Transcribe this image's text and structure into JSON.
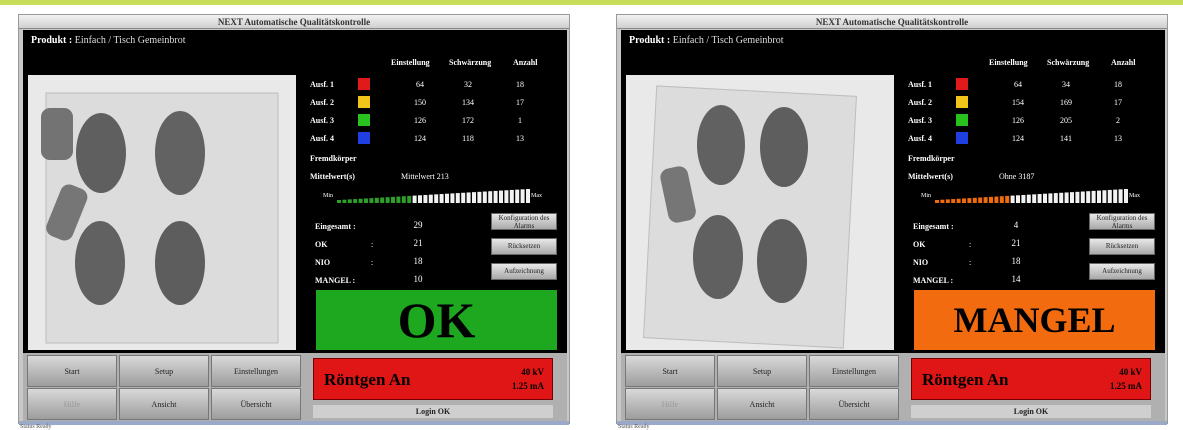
{
  "screens": [
    {
      "id": "left",
      "title": "NEXT Automatische Qualitätskontrolle",
      "produkt_label": "Produkt :",
      "produkt_value": "Einfach / Tisch Gemeinbrot",
      "headers": [
        "Einstellung",
        "Schwärzung",
        "Anzahl"
      ],
      "auswertung": [
        {
          "label": "Ausf. 1",
          "color": "#e01a1a",
          "v1": "64",
          "v2": "32",
          "v3": "18"
        },
        {
          "label": "Ausf. 2",
          "color": "#f0c419",
          "v1": "150",
          "v2": "134",
          "v3": "17"
        },
        {
          "label": "Ausf. 3",
          "color": "#27c21e",
          "v1": "126",
          "v2": "172",
          "v3": "1"
        },
        {
          "label": "Ausf. 4",
          "color": "#1f3fe0",
          "v1": "124",
          "v2": "118",
          "v3": "13"
        }
      ],
      "fremdkorper_label": "Fremdkörper",
      "mittelwert_label": "Mittelwert(s)",
      "mittelwert_value": "Mittelwert 213",
      "gauge_min": "Min",
      "gauge_max": "Max",
      "gauge_color": "#2f9e2a",
      "gauge_level": 0.4,
      "counts": [
        {
          "label": "Eingesamt :",
          "value": "29"
        },
        {
          "label": "OK",
          "value": "21"
        },
        {
          "label": "NIO",
          "value": "18"
        },
        {
          "label": "MANGEL :",
          "value": "10"
        }
      ],
      "side_buttons": [
        "Konfiguration des Alarms",
        "Rücksetzen",
        "Aufzeichnung"
      ],
      "result_text": "OK",
      "result_color": "#1ea81f",
      "nav_buttons": [
        "Start",
        "Setup",
        "Einstellungen",
        "Hilfe",
        "Ansicht",
        "Übersicht"
      ],
      "roentgen_label": "Röntgen An",
      "kv_value": "40 kV",
      "ma_value": "1.25 mA",
      "log_label": "Login OK",
      "status_text": "Status Ready"
    },
    {
      "id": "right",
      "title": "NEXT Automatische Qualitätskontrolle",
      "produkt_label": "Produkt :",
      "produkt_value": "Einfach / Tisch Gemeinbrot",
      "headers": [
        "Einstellung",
        "Schwärzung",
        "Anzahl"
      ],
      "auswertung": [
        {
          "label": "Ausf. 1",
          "color": "#e01a1a",
          "v1": "64",
          "v2": "34",
          "v3": "18"
        },
        {
          "label": "Ausf. 2",
          "color": "#f0c419",
          "v1": "154",
          "v2": "169",
          "v3": "17"
        },
        {
          "label": "Ausf. 3",
          "color": "#27c21e",
          "v1": "126",
          "v2": "205",
          "v3": "2"
        },
        {
          "label": "Ausf. 4",
          "color": "#1f3fe0",
          "v1": "124",
          "v2": "141",
          "v3": "13"
        }
      ],
      "fremdkorper_label": "Fremdkörper",
      "mittelwert_label": "Mittelwert(s)",
      "mittelwert_value": "Ohne 3187",
      "gauge_min": "Min",
      "gauge_max": "Max",
      "gauge_color": "#f06a0f",
      "gauge_level": 0.4,
      "counts": [
        {
          "label": "Eingesamt :",
          "value": "4"
        },
        {
          "label": "OK",
          "value": "21"
        },
        {
          "label": "NIO",
          "value": "18"
        },
        {
          "label": "MANGEL :",
          "value": "14"
        }
      ],
      "side_buttons": [
        "Konfiguration des Alarms",
        "Rücksetzen",
        "Aufzeichnung"
      ],
      "result_text": "MANGEL",
      "result_color": "#f26b0e",
      "nav_buttons": [
        "Start",
        "Setup",
        "Einstellungen",
        "Hilfe",
        "Ansicht",
        "Übersicht"
      ],
      "roentgen_label": "Röntgen An",
      "kv_value": "40 kV",
      "ma_value": "1.25 mA",
      "log_label": "Login OK",
      "status_text": "Status Ready"
    }
  ]
}
